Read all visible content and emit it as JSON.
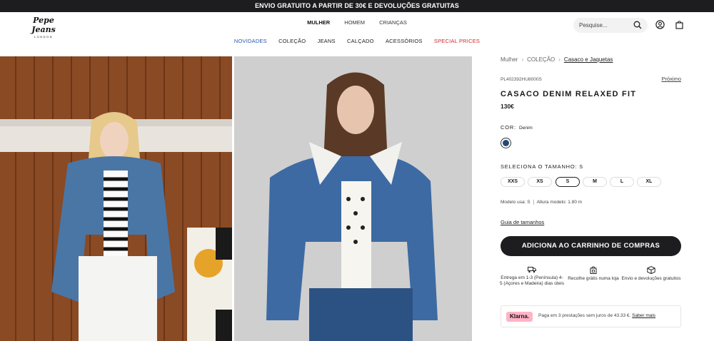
{
  "promo_banner": "ENVIO GRATUITO A PARTIR DE 30€ E DEVOLUÇÕES GRATUITAS",
  "brand": {
    "name": "Pepe Jeans",
    "sub": "LONDON"
  },
  "gender_nav": [
    "MULHER",
    "HOMEM",
    "CRIANÇAS"
  ],
  "category_nav": [
    "NOVIDADES",
    "COLEÇÃO",
    "JEANS",
    "CALÇADO",
    "ACESSÓRIOS",
    "SPECIAL PRICES"
  ],
  "search": {
    "placeholder": "Pesquise..."
  },
  "breadcrumb": [
    "Mulher",
    "COLEÇÃO",
    "Casaco e Jaquetas"
  ],
  "product": {
    "sku": "PL402392HU8000S",
    "next_label": "Próximo",
    "title": "CASACO DENIM RELAXED FIT",
    "price": "130€",
    "color_label": "COR:",
    "color_value": "Denim",
    "color_hex": "#264a76",
    "size_label": "SELECIONA O TAMANHO:",
    "size_value": "S",
    "sizes": [
      "XXS",
      "XS",
      "S",
      "M",
      "L",
      "XL"
    ],
    "selected_size": "S",
    "model_size": "Modelo usa: S",
    "model_height": "Altura modelo: 1.80 m",
    "size_guide": "Guia de tamanhos",
    "add_to_cart": "ADICIONA AO CARRINHO DE COMPRAS"
  },
  "benefits": [
    {
      "icon": "truck-icon",
      "text": "Entrega em 1-3 (Península) 4-5 (Açores e Madeira) dias úteis"
    },
    {
      "icon": "store-bag-icon",
      "text": "Recolhe grátis numa loja"
    },
    {
      "icon": "box-icon",
      "text": "Envio e devoluções gratuitos"
    }
  ],
  "klarna": {
    "badge": "Klarna.",
    "text": "Paga em 3 prestações sem juros de 43.33 €.",
    "link": "Saber mais"
  }
}
